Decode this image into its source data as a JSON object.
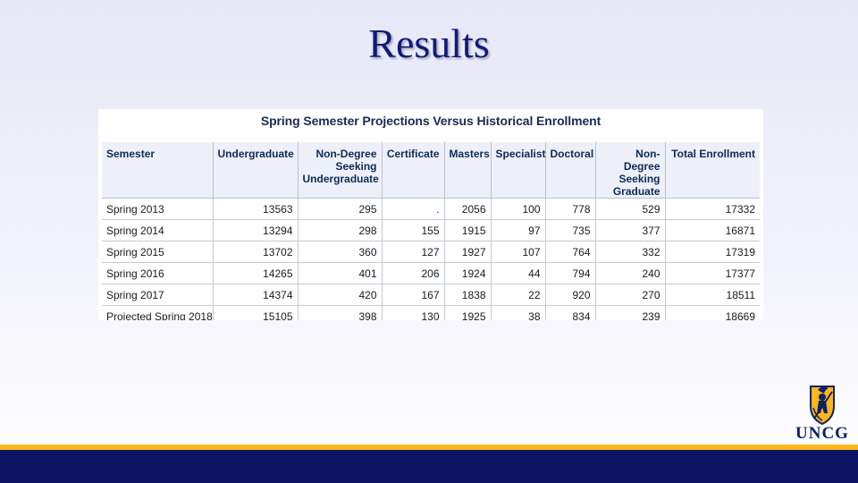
{
  "slide": {
    "title": "Results"
  },
  "table": {
    "caption": "Spring Semester Projections Versus Historical Enrollment",
    "columns": [
      [
        "Semester"
      ],
      [
        "Undergraduate"
      ],
      [
        "Non-Degree",
        "Seeking",
        "Undergraduate"
      ],
      [
        "Certificate"
      ],
      [
        "Masters"
      ],
      [
        "Specialist"
      ],
      [
        "Doctoral"
      ],
      [
        "Non-Degree",
        "Seeking",
        "Graduate"
      ],
      [
        "Total Enrollment"
      ]
    ],
    "rows": [
      [
        "Spring 2013",
        "13563",
        "295",
        ".",
        "2056",
        "100",
        "778",
        "529",
        "17332"
      ],
      [
        "Spring 2014",
        "13294",
        "298",
        "155",
        "1915",
        "97",
        "735",
        "377",
        "16871"
      ],
      [
        "Spring 2015",
        "13702",
        "360",
        "127",
        "1927",
        "107",
        "764",
        "332",
        "17319"
      ],
      [
        "Spring 2016",
        "14265",
        "401",
        "206",
        "1924",
        "44",
        "794",
        "240",
        "17377"
      ],
      [
        "Spring 2017",
        "14374",
        "420",
        "167",
        "1838",
        "22",
        "920",
        "270",
        "18511"
      ],
      [
        "Projected Spring 2018",
        "15105",
        "398",
        "130",
        "1925",
        "38",
        "834",
        "239",
        "18669"
      ]
    ]
  },
  "logo": {
    "text": "UNCG",
    "icon": "uncg-spartan-shield-icon",
    "colors": {
      "navy": "#0b2265",
      "gold": "#ffb71b"
    }
  },
  "footer": {
    "colors": {
      "gold": "#ffb71b",
      "navy": "#0b1463"
    }
  }
}
